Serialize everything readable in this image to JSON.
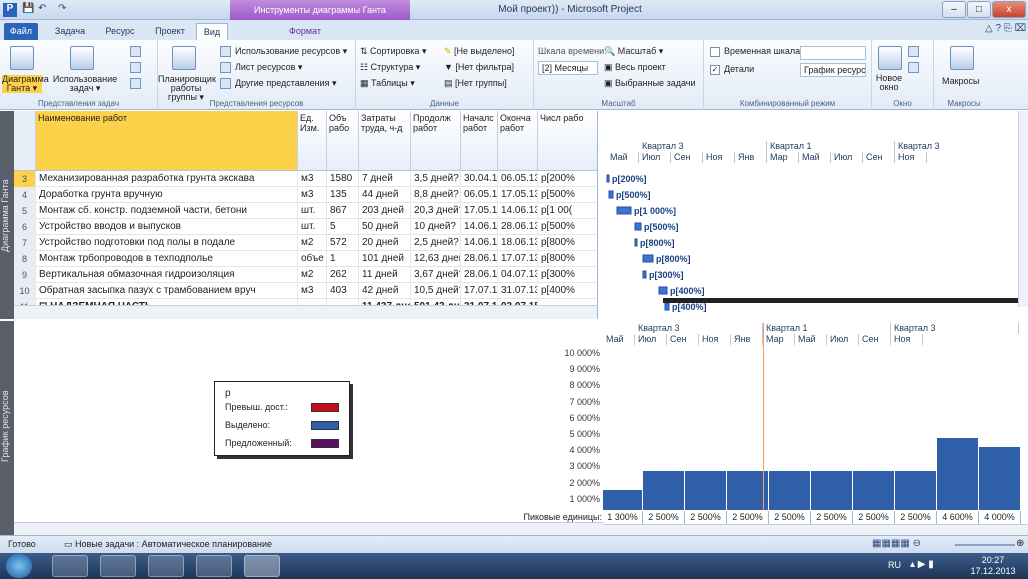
{
  "window": {
    "contextual_tab_title": "Инструменты диаграммы Ганта",
    "title": "Мой проект)) - Microsoft Project",
    "qat": {
      "app_icon": "P",
      "save_icon": "save-icon",
      "undo_icon": "undo-icon",
      "redo_icon": "redo-icon"
    },
    "buttons": {
      "minimize": "–",
      "maximize": "□",
      "close": "x"
    }
  },
  "tabs": [
    "Файл",
    "Задача",
    "Ресурс",
    "Проект",
    "Вид",
    "Формат"
  ],
  "active_tab": "Вид",
  "ribbon": {
    "groups": [
      "Представления задач",
      "Представления ресурсов",
      "Данные",
      "Масштаб",
      "Комбинированный режим",
      "Окно",
      "Макросы"
    ],
    "task_views": {
      "gantt": "Диаграмма Ганта ▾",
      "usage": "Использование задач ▾"
    },
    "resource_views": {
      "planner": "Планировщик работы группы ▾",
      "usage": "Использование ресурсов ▾",
      "sheet": "Лист ресурсов ▾",
      "other": "Другие представления ▾"
    },
    "data": {
      "sort": "Сортировка ▾",
      "structure": "Структура ▾",
      "tables": "Таблицы ▾",
      "highlight": "[Не выделено]",
      "filter": "[Нет фильтра]",
      "group": "[Нет группы]"
    },
    "zoom": {
      "timescale_label": "Шкала времени:",
      "timescale_value": "[2] Месяцы",
      "zoom": "Масштаб ▾",
      "entire_project": "Весь проект",
      "selected_tasks": "Выбранные задачи"
    },
    "split": {
      "timeline": "Временная шкала",
      "details": "Детали",
      "details_checked": true,
      "timeline_checked": false,
      "details_view": "График ресурс"
    },
    "window": {
      "new_window": "Новое окно"
    },
    "macros": {
      "macros": "Макросы"
    }
  },
  "side_labels": {
    "top": "Диаграмма Ганта",
    "bottom": "График ресурсов"
  },
  "table": {
    "columns": [
      "Наименование работ",
      "Ед. Изм.",
      "Объ рабо",
      "Затраты труда, ч-д",
      "Продолж работ",
      "Началс работ",
      "Оконча работ",
      "Числ рабо"
    ],
    "rows": [
      {
        "id": "3",
        "name": "Механизированная разработка грунта экскава",
        "unit": "м3",
        "vol": "1580",
        "labor": "7 дней",
        "dur": "3,5 дней?",
        "start": "30.04.13",
        "end": "06.05.13",
        "num": "р[200%",
        "selected": true
      },
      {
        "id": "4",
        "name": "Доработка грунта вручную",
        "unit": "м3",
        "vol": "135",
        "labor": "44 дней",
        "dur": "8,8 дней?",
        "start": "06.05.13",
        "end": "17.05.13",
        "num": "р[500%"
      },
      {
        "id": "5",
        "name": "Монтаж сб. констр. подземной части, бетони",
        "unit": "шт.",
        "vol": "867",
        "labor": "203 дней",
        "dur": "20,3 дней?",
        "start": "17.05.13",
        "end": "14.06.13",
        "num": "р[1 00("
      },
      {
        "id": "6",
        "name": "Устройство вводов и выпусков",
        "unit": "шт.",
        "vol": "5",
        "labor": "50 дней",
        "dur": "10 дней?",
        "start": "14.06.13",
        "end": "28.06.13",
        "num": "р[500%"
      },
      {
        "id": "7",
        "name": "Устройство подготовки под полы в подале",
        "unit": "м2",
        "vol": "572",
        "labor": "20 дней",
        "dur": "2,5 дней?",
        "start": "14.06.13",
        "end": "18.06.13",
        "num": "р[800%"
      },
      {
        "id": "8",
        "name": "Монтаж трбопроводов в техподполье",
        "unit": "объе",
        "vol": "1",
        "labor": "101 дней",
        "dur": "12,63 дней",
        "start": "28.06.13",
        "end": "17.07.13",
        "num": "р[800%"
      },
      {
        "id": "9",
        "name": "Вертикальная обмазочная гидроизоляция",
        "unit": "м2",
        "vol": "262",
        "labor": "11 дней",
        "dur": "3,67 дней?",
        "start": "28.06.13",
        "end": "04.07.13",
        "num": "р[300%"
      },
      {
        "id": "10",
        "name": "Обратная засыпка пазух с трамбованием вруч",
        "unit": "м3",
        "vol": "403",
        "labor": "42 дней",
        "dur": "10,5 дней?",
        "start": "17.07.13",
        "end": "31.07.13",
        "num": "р[400%"
      },
      {
        "id": "11",
        "name": "⊟ НАДЗЕМНАЯ ЧАСТЬ",
        "unit": "",
        "vol": "",
        "labor": "11 437 дней",
        "dur": "501,43 дне",
        "start": "31.07.13",
        "end": "03.07.15",
        "num": "",
        "bold": true
      }
    ]
  },
  "timescale": {
    "quarters": [
      "Квартал 3",
      "Квартал 1",
      "Квартал 3"
    ],
    "months": [
      "Май",
      "Июл",
      "Сен",
      "Ноя",
      "Янв",
      "Мар",
      "Май",
      "Июл",
      "Сен",
      "Ноя"
    ]
  },
  "gantt_labels": [
    "р[200%]",
    "р[500%]",
    "р[1 000%]",
    "р[500%]",
    "р[800%]",
    "р[800%]",
    "р[300%]",
    "р[400%]",
    "р[400%]"
  ],
  "legend": {
    "title": "р",
    "items": [
      {
        "label": "Превыш. дост.:",
        "color": "#c40f1a"
      },
      {
        "label": "Выделено:",
        "color": "#2f5fa9"
      },
      {
        "label": "Предложенный:",
        "color": "#5b1060"
      }
    ]
  },
  "histogram": {
    "y_ticks": [
      "10 000%",
      "9 000%",
      "8 000%",
      "7 000%",
      "6 000%",
      "5 000%",
      "4 000%",
      "3 000%",
      "2 000%",
      "1 000%"
    ],
    "peak_label": "Пиковые единицы:",
    "peaks": [
      "1 300%",
      "2 500%",
      "2 500%",
      "2 500%",
      "2 500%",
      "2 500%",
      "2 500%",
      "2 500%",
      "4 600%",
      "4 000%"
    ]
  },
  "chart_data": {
    "type": "bar",
    "categories": [
      "Май",
      "Июл",
      "Сен",
      "Ноя",
      "Янв",
      "Мар",
      "Май",
      "Июл",
      "Сен",
      "Ноя"
    ],
    "series": [
      {
        "values": [
          1300,
          2500,
          2500,
          2500,
          2500,
          2500,
          2500,
          2500,
          4600,
          4000
        ]
      }
    ],
    "ylim": [
      0,
      10500
    ],
    "ylabel": "",
    "xlabel": ""
  },
  "status": {
    "ready": "Готово",
    "new_tasks": "Новые задачи : Автоматическое планирование"
  },
  "taskbar": {
    "lang": "RU",
    "time": "20:27",
    "date": "17.12.2013"
  }
}
